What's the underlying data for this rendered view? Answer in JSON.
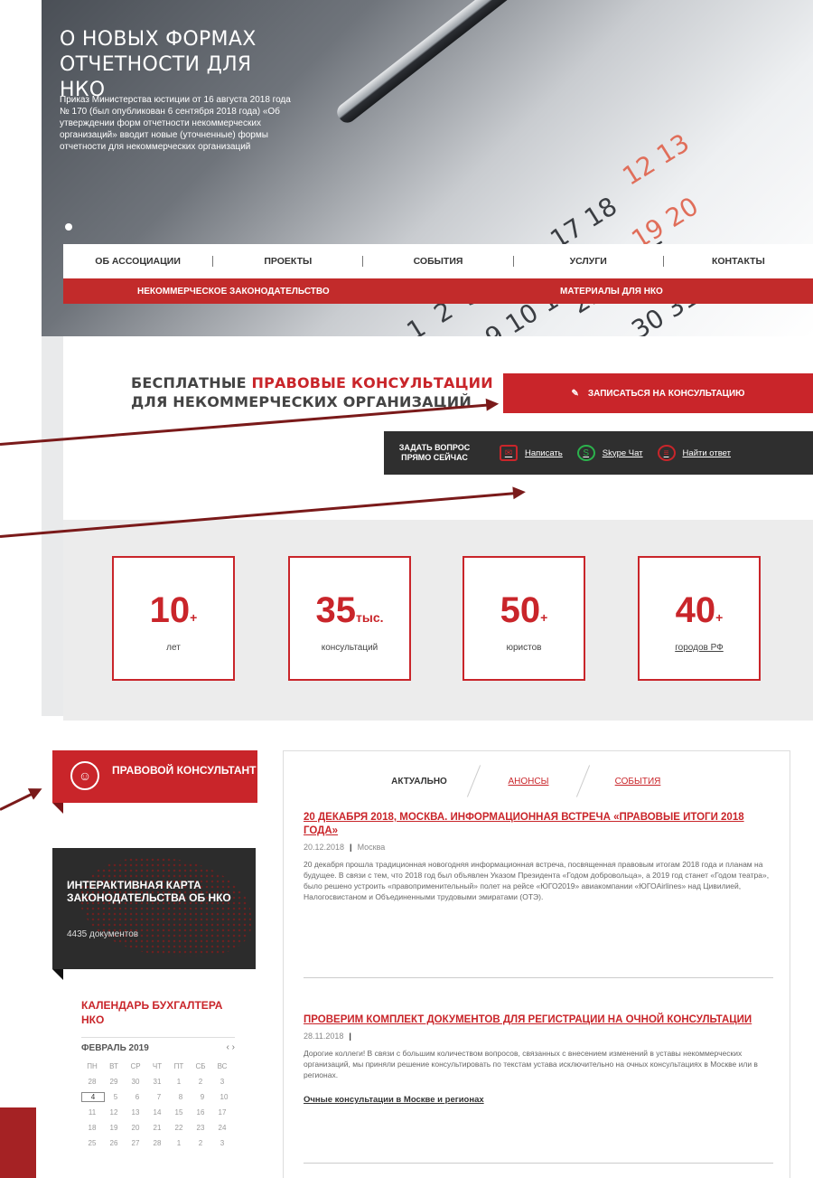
{
  "hero": {
    "title": "О НОВЫХ ФОРМАХ ОТЧЕТНОСТИ ДЛЯ НКО",
    "text": "Приказ Министерства юстиции от 16 августа 2018 года № 170 (был опубликован 6 сентября 2018 года) «Об утверждении форм отчетности некоммерческих организаций» вводит новые (уточненные) формы отчетности для некоммерческих организаций"
  },
  "nav": {
    "items": [
      "ОБ АССОЦИАЦИИ",
      "ПРОЕКТЫ",
      "СОБЫТИЯ",
      "УСЛУГИ",
      "КОНТАКТЫ"
    ]
  },
  "subnav": {
    "left": "НЕКОММЕРЧЕСКОЕ ЗАКОНОДАТЕЛЬСТВО",
    "right": "МАТЕРИАЛЫ ДЛЯ НКО"
  },
  "consult": {
    "title_prefix": "БЕСПЛАТНЫЕ ",
    "title_red": "ПРАВОВЫЕ КОНСУЛЬТАЦИИ",
    "title_line2": "ДЛЯ НЕКОММЕРЧЕСКИХ ОРГАНИЗАЦИЙ",
    "button": "ЗАПИСАТЬСЯ НА КОНСУЛЬТАЦИЮ"
  },
  "ask": {
    "label": "ЗАДАТЬ ВОПРОС ПРЯМО СЕЙЧАС",
    "write": "Написать",
    "skype": "Skype Чат",
    "find": "Найти ответ"
  },
  "stats": [
    {
      "value": "10",
      "suffix": "+",
      "label": "лет"
    },
    {
      "value": "35",
      "suffix": "тыс.",
      "label": "консультаций"
    },
    {
      "value": "50",
      "suffix": "+",
      "label": "юристов"
    },
    {
      "value": "40",
      "suffix": "+",
      "label": "городов РФ"
    }
  ],
  "sidebar": {
    "lawyer": "ПРАВОВОЙ КОНСУЛЬТАНТ",
    "map_title": "ИНТЕРАКТИВНАЯ КАРТА ЗАКОНОДАТЕЛЬСТВА ОБ НКО",
    "map_docs": "4435 документов",
    "calendar_title": "КАЛЕНДАРЬ БУХГАЛТЕРА НКО",
    "calendar_month": "ФЕВРАЛЬ 2019",
    "calendar_nav": "‹  ›",
    "weekdays": [
      "ПН",
      "ВТ",
      "СР",
      "ЧТ",
      "ПТ",
      "СБ",
      "ВС"
    ],
    "weeks": [
      [
        "28",
        "29",
        "30",
        "31",
        "1",
        "2",
        "3"
      ],
      [
        "4",
        "5",
        "6",
        "7",
        "8",
        "9",
        "10"
      ],
      [
        "11",
        "12",
        "13",
        "14",
        "15",
        "16",
        "17"
      ],
      [
        "18",
        "19",
        "20",
        "21",
        "22",
        "23",
        "24"
      ],
      [
        "25",
        "26",
        "27",
        "28",
        "1",
        "2",
        "3"
      ]
    ]
  },
  "news": {
    "tabs": [
      "АКТУАЛЬНО",
      "АНОНСЫ",
      "СОБЫТИЯ"
    ],
    "items": [
      {
        "title": "20 ДЕКАБРЯ 2018, МОСКВА. ИНФОРМАЦИОННАЯ ВСТРЕЧА «ПРАВОВЫЕ ИТОГИ 2018 ГОДА»",
        "date": "20.12.2018",
        "place": "Москва",
        "body": "20 декабря прошла традиционная новогодняя информационная встреча, посвященная правовым итогам 2018 года и планам на будущее. В связи с тем, что 2018 год был объявлен Указом Президента «Годом добровольца», а 2019 год станет «Годом театра», было решено устроить «правоприменительный» полет на рейсе «ЮГО2019» авиакомпании «ЮГОAirlines» над Цивилией, Налогосвистаном и Объединенными трудовыми эмиратами (ОТЭ).",
        "more": ""
      },
      {
        "title": "ПРОВЕРИМ КОМПЛЕКТ ДОКУМЕНТОВ ДЛЯ РЕГИСТРАЦИИ НА ОЧНОЙ КОНСУЛЬТАЦИИ",
        "date": "28.11.2018",
        "place": "",
        "body": "Дорогие коллеги! В связи с большим количеством вопросов, связанных с внесением изменений в уставы некоммерческих организаций, мы приняли решение консультировать по текстам устава исключительно на очных консультациях в Москве или в регионах.",
        "more": "Очные консультации в Москве и регионах"
      }
    ]
  },
  "colors": {
    "accent": "#c9252a",
    "dark": "#2f2f2f",
    "arrow": "#7a1a1a"
  }
}
